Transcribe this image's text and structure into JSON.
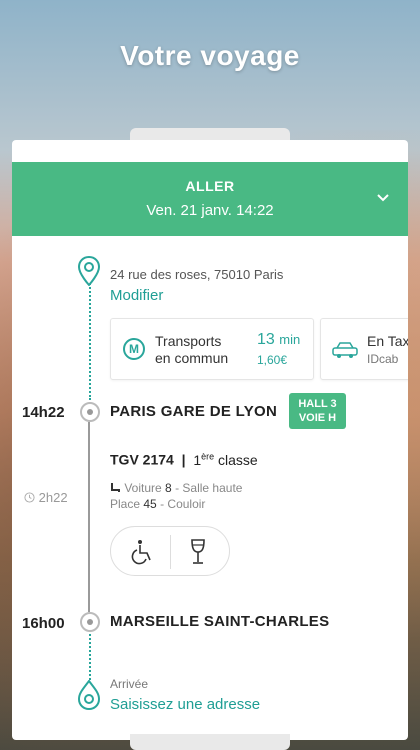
{
  "hero": {
    "title": "Votre voyage"
  },
  "header": {
    "direction": "ALLER",
    "date": "Ven. 21 janv. 14:22"
  },
  "origin": {
    "address": "24 rue des roses, 75010 Paris",
    "modify": "Modifier"
  },
  "transport_options": [
    {
      "label_line1": "Transports",
      "label_line2": "en commun",
      "duration": "13",
      "unit": "min",
      "price": "1,60€",
      "icon": "metro-icon"
    },
    {
      "label": "En Taxi",
      "provider": "IDcab",
      "icon": "taxi-icon"
    }
  ],
  "departure": {
    "time": "14h22",
    "station": "PARIS GARE DE LYON",
    "hall_line1": "HALL 3",
    "hall_line2": "VOIE H"
  },
  "train": {
    "number": "TGV 2174",
    "class_prefix": "1",
    "class_sup": "ère",
    "class_suffix": " classe",
    "voiture_label": "Voiture",
    "voiture_num": "8",
    "voiture_rest": "- Salle haute",
    "place_label": "Place",
    "place_num": "45",
    "place_rest": "- Couloir",
    "duration": "2h22",
    "amenities": [
      "wheelchair-icon",
      "wine-glass-icon"
    ]
  },
  "arrival": {
    "time": "16h00",
    "station": "MARSEILLE SAINT-CHARLES",
    "label": "Arrivée",
    "placeholder": "Saisissez une adresse"
  },
  "colors": {
    "accent": "#49b984",
    "teal": "#2aa69b"
  }
}
